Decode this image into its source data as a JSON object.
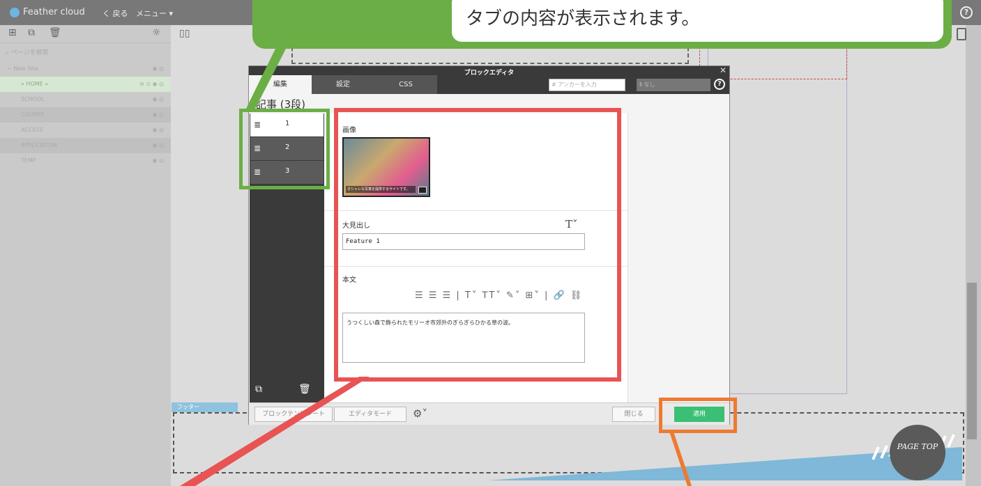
{
  "app": {
    "logo_text": "Feather cloud",
    "back_label": "く 戻る",
    "menu_label": "メニュー ▾",
    "help_glyph": "?"
  },
  "left_panel": {
    "search_placeholder": "ページを検索",
    "tree": [
      {
        "label": "− New Site",
        "state": "normal"
      },
      {
        "label": "» HOME «",
        "state": "selected"
      },
      {
        "label": "SCHOOL",
        "state": "normal"
      },
      {
        "label": "COURSE",
        "state": "alt"
      },
      {
        "label": "ACCESS",
        "state": "normal"
      },
      {
        "label": "APPLICATION",
        "state": "alt"
      },
      {
        "label": "TEMP",
        "state": "normal"
      }
    ]
  },
  "canvas": {
    "footer_label": "フッター",
    "page_top": "PAGE TOP"
  },
  "modal": {
    "title": "ブロックエディタ",
    "tabs": [
      "編集",
      "設定",
      "CSS"
    ],
    "anchor_placeholder": "# アンカーを入力",
    "anchor_select": "Ⅱ なし",
    "block_heading": "記事 (3段)",
    "side_items": [
      "1",
      "2",
      "3"
    ],
    "fields": {
      "image_label": "画像",
      "image_caption": "オシャレな写真を提供するサイトです。",
      "heading_label": "大見出し",
      "heading_value": "Feature 1",
      "body_label": "本文",
      "body_value": "うつくしい森で飾られたモリーオ市郊外のぎらぎらひかる草の波。",
      "toolbar_glyphs": "☰ ☰ ☰ | T˅ ꓔT˅ ✎˅ ⊞˅ | 🔗 ⛓"
    },
    "footer": {
      "template_label": "ブロックテンプレート",
      "editor_mode_label": "エディタモード",
      "gear_label": "⚙˅",
      "close_label": "閉じる",
      "apply_label": "適用"
    }
  },
  "annotation": {
    "callout_text": "タブの内容が表示されます。",
    "colors": {
      "green": "#6cae46",
      "red": "#e85454",
      "orange": "#ee7a31"
    }
  }
}
